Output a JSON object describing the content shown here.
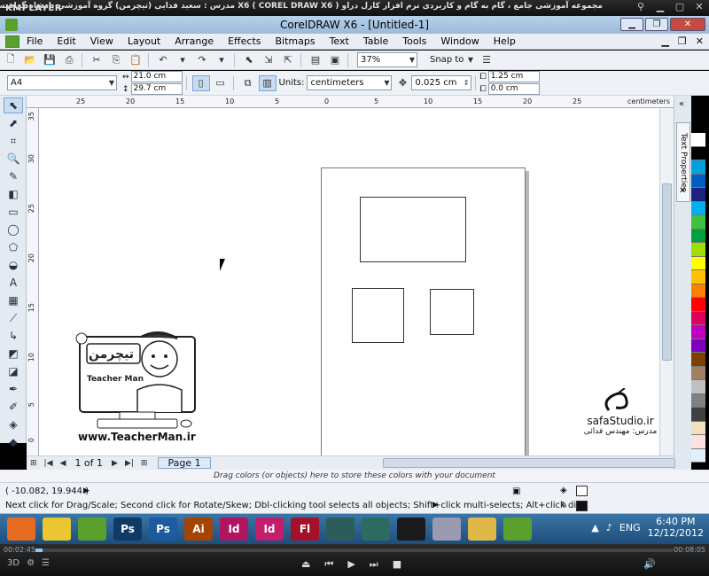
{
  "kmplayer": {
    "logo": "KMPLAYER",
    "caption": "مجموعه آموزشی جامع ، گام به گام و کاربردی نرم افزار کارل دراو X6 ( COREL DRAW X6 )   مدرس : سعید فدایی (تیچرمن) گروه آموزشی پادشاه گرافیست ها",
    "time_elapsed": "00:02:45",
    "time_total": "00:08:05"
  },
  "window": {
    "title": "CorelDRAW X6 - [Untitled-1]"
  },
  "menu": [
    "File",
    "Edit",
    "View",
    "Layout",
    "Arrange",
    "Effects",
    "Bitmaps",
    "Text",
    "Table",
    "Tools",
    "Window",
    "Help"
  ],
  "standard_bar": {
    "zoom": "37%",
    "snap_to": "Snap to"
  },
  "property_bar": {
    "paper_size": "A4",
    "width": "21.0 cm",
    "height": "29.7 cm",
    "units_label": "Units:",
    "units": "centimeters",
    "nudge": "0.025 cm",
    "dup_x": "1.25 cm",
    "dup_y": "0.0 cm"
  },
  "ruler": {
    "unit": "centimeters",
    "top_ticks": [
      "25",
      "20",
      "15",
      "10",
      "5",
      "0",
      "5",
      "10",
      "15",
      "20",
      "25"
    ],
    "left_ticks": [
      "35",
      "30",
      "25",
      "20",
      "15",
      "10",
      "5",
      "0"
    ]
  },
  "pages": {
    "nav_count": "1 of 1",
    "tab": "Page 1"
  },
  "docker": {
    "tab": "Text Properties"
  },
  "color_tray": {
    "hint": "Drag colors (or objects) here to store these colors with your document"
  },
  "status": {
    "coords": "( -10.082, 19.944 )",
    "hint": "Next click for Drag/Scale; Second click for Rotate/Skew; Dbl-clicking tool selects all objects; Shift+click multi-selects; Alt+click digs"
  },
  "taskbar": {
    "apps": [
      {
        "label": "",
        "color": "#e66a1f"
      },
      {
        "label": "",
        "color": "#e9c632"
      },
      {
        "label": "",
        "color": "#5aa02c"
      },
      {
        "label": "Ps",
        "color": "#0f3a66"
      },
      {
        "label": "Ps",
        "color": "#1d5aa0"
      },
      {
        "label": "Ai",
        "color": "#a44400"
      },
      {
        "label": "Id",
        "color": "#b0155f"
      },
      {
        "label": "Id",
        "color": "#c21e6a"
      },
      {
        "label": "Fl",
        "color": "#a3112b"
      },
      {
        "label": "",
        "color": "#2c5d5b"
      },
      {
        "label": "",
        "color": "#2c6b62"
      },
      {
        "label": "",
        "color": "#1a1a1a"
      },
      {
        "label": "",
        "color": "#9a9ab0"
      },
      {
        "label": "",
        "color": "#e0b84a"
      },
      {
        "label": "",
        "color": "#5aa02c"
      }
    ],
    "lang": "ENG",
    "time": "6:40 PM",
    "date": "12/12/2012"
  },
  "watermarks": {
    "teacherman_site": "www.TeacherMan.ir",
    "teacherman_name": "Teacher Man",
    "teacherman_fa": "تیچرمن",
    "safa_site": "safaStudio.ir",
    "safa_teacher": "مدرس: مهندس فدائی"
  },
  "palette": [
    "#ffffff",
    "#000000",
    "#00a0e0",
    "#0060c0",
    "#1a237e",
    "#00b0f0",
    "#40c040",
    "#00a040",
    "#a0e000",
    "#ffff00",
    "#ffc000",
    "#ff8000",
    "#ff0000",
    "#e00060",
    "#c000c0",
    "#8000c0",
    "#804000",
    "#a08060",
    "#c0c0c0",
    "#808080",
    "#404040",
    "#f0e0c0",
    "#ffe0e0",
    "#e0f0ff"
  ]
}
